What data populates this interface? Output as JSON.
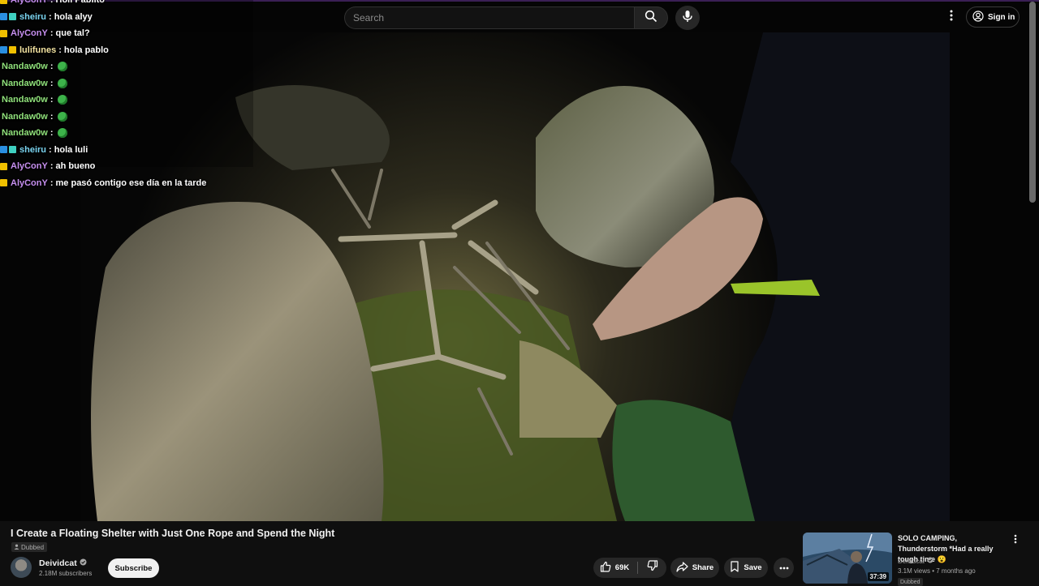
{
  "masthead": {
    "search_placeholder": "Search",
    "sign_in_label": "Sign in",
    "icons": [
      "search-icon",
      "mic-icon",
      "more-vert-icon",
      "account-circle-icon"
    ]
  },
  "chat": [
    {
      "user": "AlyConY",
      "message": "Holi Pablito",
      "user_color": "#c68fef",
      "badges": [
        "a"
      ]
    },
    {
      "user": "sheiru",
      "message": "hola alyy",
      "user_color": "#7ad4f0",
      "badges": [
        "b",
        "c"
      ]
    },
    {
      "user": "AlyConY",
      "message": "que tal?",
      "user_color": "#c68fef",
      "badges": [
        "a"
      ]
    },
    {
      "user": "lulifunes",
      "message": "hola pablo",
      "user_color": "#f2e2a0",
      "badges": [
        "b",
        "a"
      ]
    },
    {
      "user": "Nandaw0w",
      "message": "",
      "user_color": "#8fe07a",
      "badges": [],
      "emote": true
    },
    {
      "user": "Nandaw0w",
      "message": "",
      "user_color": "#8fe07a",
      "badges": [],
      "emote": true
    },
    {
      "user": "Nandaw0w",
      "message": "",
      "user_color": "#8fe07a",
      "badges": [],
      "emote": true
    },
    {
      "user": "Nandaw0w",
      "message": "",
      "user_color": "#8fe07a",
      "badges": [],
      "emote": true
    },
    {
      "user": "Nandaw0w",
      "message": "",
      "user_color": "#8fe07a",
      "badges": [],
      "emote": true
    },
    {
      "user": "sheiru",
      "message": "hola luli",
      "user_color": "#7ad4f0",
      "badges": [
        "b",
        "c"
      ]
    },
    {
      "user": "AlyConY",
      "message": "ah bueno",
      "user_color": "#c68fef",
      "badges": [
        "a"
      ]
    },
    {
      "user": "AlyConY",
      "message": "me pasó contigo ese día en la tarde",
      "user_color": "#c68fef",
      "badges": [
        "a"
      ]
    }
  ],
  "video": {
    "title": "I Create a Floating Shelter with Just One Rope and Spend the Night",
    "dubbed_label": "Dubbed",
    "channel_name": "Deividcat",
    "subscribers": "2.18M subscribers",
    "subscribe_label": "Subscribe",
    "likes": "69K",
    "share_label": "Share",
    "save_label": "Save"
  },
  "related": {
    "title": "SOLO CAMPING, Thunderstorm *Had a really tough time 😮",
    "channel": "Deividcat",
    "meta": "3.1M views • 7 months ago",
    "duration": "37:39",
    "dubbed_label": "Dubbed"
  },
  "colors": {
    "background": "#0f0f0f",
    "pill": "#272727",
    "text_secondary": "#aaaaaa"
  }
}
